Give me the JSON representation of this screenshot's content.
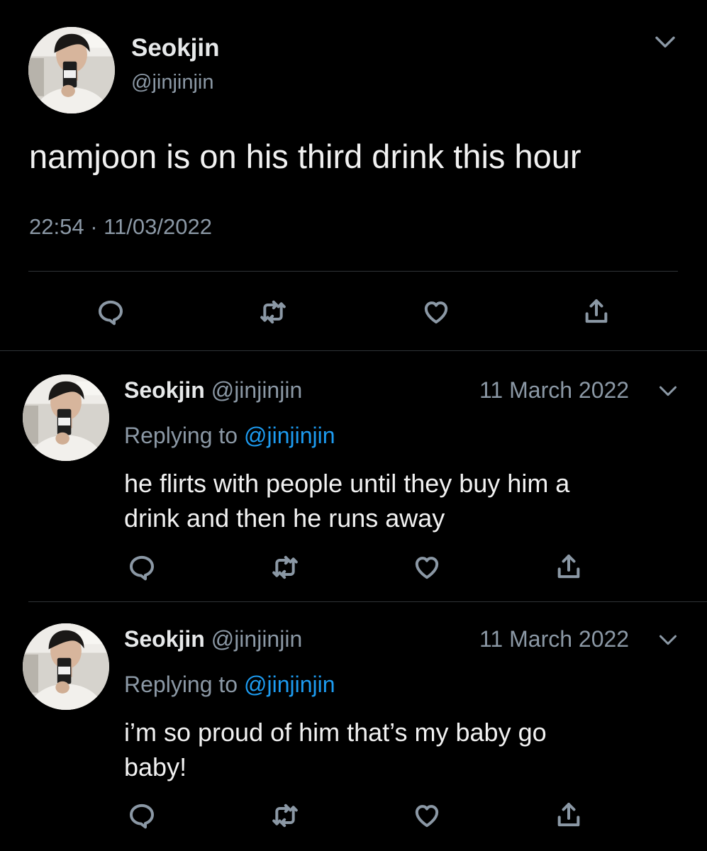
{
  "main_tweet": {
    "author_name": "Seokjin",
    "author_handle": "@jinjinjin",
    "text": "namjoon is on his third drink this hour",
    "timestamp": "22:54 · 11/03/2022",
    "avatar_icon": "profile-photo"
  },
  "replies": [
    {
      "author_name": "Seokjin",
      "author_handle": "@jinjinjin",
      "date": "11 March 2022",
      "replying_label": "Replying to",
      "replying_handle": "@jinjinjin",
      "text_line1": "he flirts with people until they buy him a",
      "text_line2": "drink and then he runs away"
    },
    {
      "author_name": "Seokjin",
      "author_handle": "@jinjinjin",
      "date": "11 March 2022",
      "replying_label": "Replying to",
      "replying_handle": "@jinjinjin",
      "text_line1": "i’m so proud of him that’s my baby go",
      "text_line2": "baby!"
    }
  ],
  "actions": [
    "reply-icon",
    "retweet-icon",
    "like-icon",
    "share-icon"
  ],
  "colors": {
    "background": "#000000",
    "text": "#e7e9ea",
    "muted": "#8b98a5",
    "link": "#1d9bf0",
    "divider": "#2f3336"
  }
}
